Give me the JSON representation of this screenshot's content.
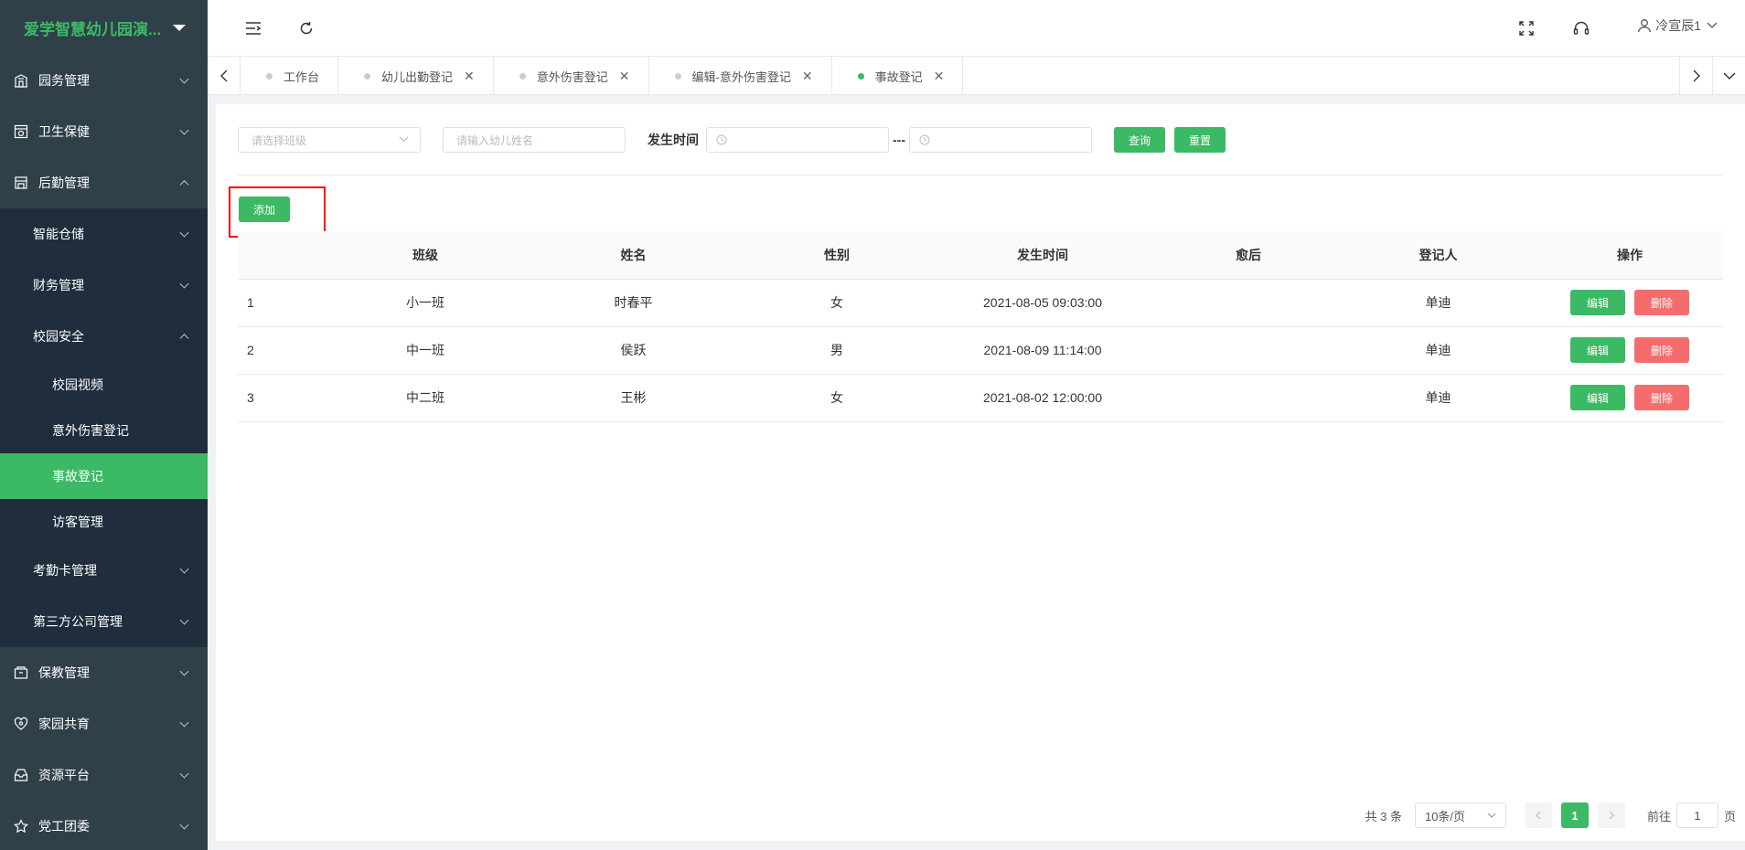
{
  "app": {
    "title": "爱学智慧幼儿园演..."
  },
  "sidebar": {
    "items": [
      {
        "label": "园务管理",
        "icon": "building-icon"
      },
      {
        "label": "卫生保健",
        "icon": "health-icon"
      },
      {
        "label": "后勤管理",
        "icon": "logistics-icon"
      }
    ],
    "sub": {
      "warehouse": "智能仓储",
      "finance": "财务管理",
      "safety": "校园安全",
      "video": "校园视频",
      "injury": "意外伤害登记",
      "accident": "事故登记",
      "visitor": "访客管理",
      "attendance_card": "考勤卡管理",
      "third_party": "第三方公司管理"
    },
    "bottom_items": [
      {
        "label": "保教管理",
        "icon": "education-icon"
      },
      {
        "label": "家园共育",
        "icon": "heart-icon"
      },
      {
        "label": "资源平台",
        "icon": "resource-icon"
      },
      {
        "label": "党工团委",
        "icon": "star-icon"
      }
    ]
  },
  "topbar": {
    "user": "冷宣辰1"
  },
  "tabs": [
    {
      "label": "工作台",
      "closable": false,
      "active": false
    },
    {
      "label": "幼儿出勤登记",
      "closable": true,
      "active": false
    },
    {
      "label": "意外伤害登记",
      "closable": true,
      "active": false
    },
    {
      "label": "编辑-意外伤害登记",
      "closable": true,
      "active": false
    },
    {
      "label": "事故登记",
      "closable": true,
      "active": true
    }
  ],
  "filter": {
    "class_placeholder": "请选择班级",
    "name_placeholder": "请输入幼儿姓名",
    "time_label": "发生时间",
    "separator": "---",
    "query": "查询",
    "reset": "重置"
  },
  "add_label": "添加",
  "table": {
    "headers": [
      "",
      "班级",
      "姓名",
      "性别",
      "发生时间",
      "愈后",
      "登记人",
      "操作"
    ],
    "rows": [
      {
        "idx": "1",
        "class": "小一班",
        "name": "时春平",
        "gender": "女",
        "time": "2021-08-05 09:03:00",
        "recovery": "",
        "registrar": "单迪"
      },
      {
        "idx": "2",
        "class": "中一班",
        "name": "侯跃",
        "gender": "男",
        "time": "2021-08-09 11:14:00",
        "recovery": "",
        "registrar": "单迪"
      },
      {
        "idx": "3",
        "class": "中二班",
        "name": "王彬",
        "gender": "女",
        "time": "2021-08-02 12:00:00",
        "recovery": "",
        "registrar": "单迪"
      }
    ],
    "edit": "编辑",
    "delete": "删除"
  },
  "pagination": {
    "total": "共 3 条",
    "page_size": "10条/页",
    "current": "1",
    "goto_prefix": "前往",
    "goto_value": "1",
    "goto_suffix": "页"
  },
  "colors": {
    "accent": "#3cb964",
    "sidebar": "#304049",
    "danger": "#f56c6c"
  }
}
